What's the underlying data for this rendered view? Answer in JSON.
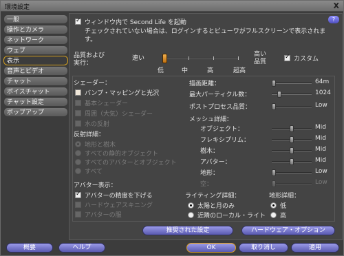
{
  "window": {
    "title": "環境設定",
    "close": "X"
  },
  "sidebar": {
    "items": [
      {
        "label": "一般"
      },
      {
        "label": "操作とカメラ"
      },
      {
        "label": "ネットワーク"
      },
      {
        "label": "ウェブ"
      },
      {
        "label": "表示",
        "active": true
      },
      {
        "label": "音声とビデオ"
      },
      {
        "label": "チャット"
      },
      {
        "label": "ボイスチャット"
      },
      {
        "label": "チャット設定"
      },
      {
        "label": "ポップアップ"
      }
    ]
  },
  "display": {
    "windowed_label": "ウィンドウ内で Second Life を起動",
    "windowed_note": "チェックされていない場合は、ログインするとビューワがフルスクリーンで表示されます。",
    "help": "?",
    "quality_label": "品質および実行：",
    "quality_fast": "速い",
    "quality_high": "高い品質",
    "quality_custom": "カスタム",
    "quality_level": 0.0,
    "quality_ticks": [
      "低",
      "中",
      "高",
      "超高"
    ],
    "shaders": {
      "title": "シェーダー：",
      "items": [
        {
          "label": "バンプ・マッピングと光沢",
          "checked": false,
          "enabled": true
        },
        {
          "label": "基本シェーダー",
          "checked": false,
          "enabled": false
        },
        {
          "label": "周囲（大気）シェーダー",
          "checked": false,
          "enabled": false
        },
        {
          "label": "水の反射",
          "checked": false,
          "enabled": false
        }
      ]
    },
    "reflections": {
      "title": "反射詳細：",
      "items": [
        {
          "label": "地形と樹木",
          "selected": true
        },
        {
          "label": "すべての静的オブジェクト",
          "selected": false
        },
        {
          "label": "すべてのアバターとオブジェクト",
          "selected": false
        },
        {
          "label": "すべて",
          "selected": false
        }
      ]
    },
    "avatar": {
      "title": "アバター表示：",
      "items": [
        {
          "label": "アバターの精度を下げる",
          "checked": true,
          "enabled": true
        },
        {
          "label": "ハードウェアスキニング",
          "checked": false,
          "enabled": false
        },
        {
          "label": "アバターの服",
          "checked": false,
          "enabled": false
        }
      ]
    },
    "draw_distance": {
      "label": "描画距離：",
      "value": "64m",
      "level": 0.0
    },
    "max_particles": {
      "label": "最大パーティクル数：",
      "value": "1024",
      "level": 0.15
    },
    "post_process": {
      "label": "ポストプロセス品質：",
      "value": "Low",
      "level": 0.0
    },
    "mesh": {
      "title": "メッシュ詳細：",
      "rows": [
        {
          "label": "オブジェクト：",
          "value": "Mid",
          "level": 0.5,
          "enabled": true
        },
        {
          "label": "フレキシプリム：",
          "value": "Mid",
          "level": 0.5,
          "enabled": true
        },
        {
          "label": "樹木：",
          "value": "Mid",
          "level": 0.5,
          "enabled": true
        },
        {
          "label": "アバター：",
          "value": "Mid",
          "level": 0.5,
          "enabled": true
        },
        {
          "label": "地形：",
          "value": "Low",
          "level": 0.0,
          "enabled": true
        },
        {
          "label": "空：",
          "value": "Low",
          "level": 0.0,
          "enabled": false
        }
      ]
    },
    "lighting": {
      "title": "ライティング詳細：",
      "items": [
        {
          "label": "太陽と月のみ",
          "selected": true
        },
        {
          "label": "近隣のローカル・ライト",
          "selected": false
        }
      ]
    },
    "terrain": {
      "title": "地形詳細：",
      "items": [
        {
          "label": "低",
          "selected": true
        },
        {
          "label": "高",
          "selected": false
        }
      ]
    },
    "recommended_button": "推奨された設定",
    "hardware_button": "ハードウェア・オプション"
  },
  "footer": {
    "about": "概要",
    "help": "ヘルプ",
    "ok": "OK",
    "cancel": "取り消し",
    "apply": "適用"
  }
}
